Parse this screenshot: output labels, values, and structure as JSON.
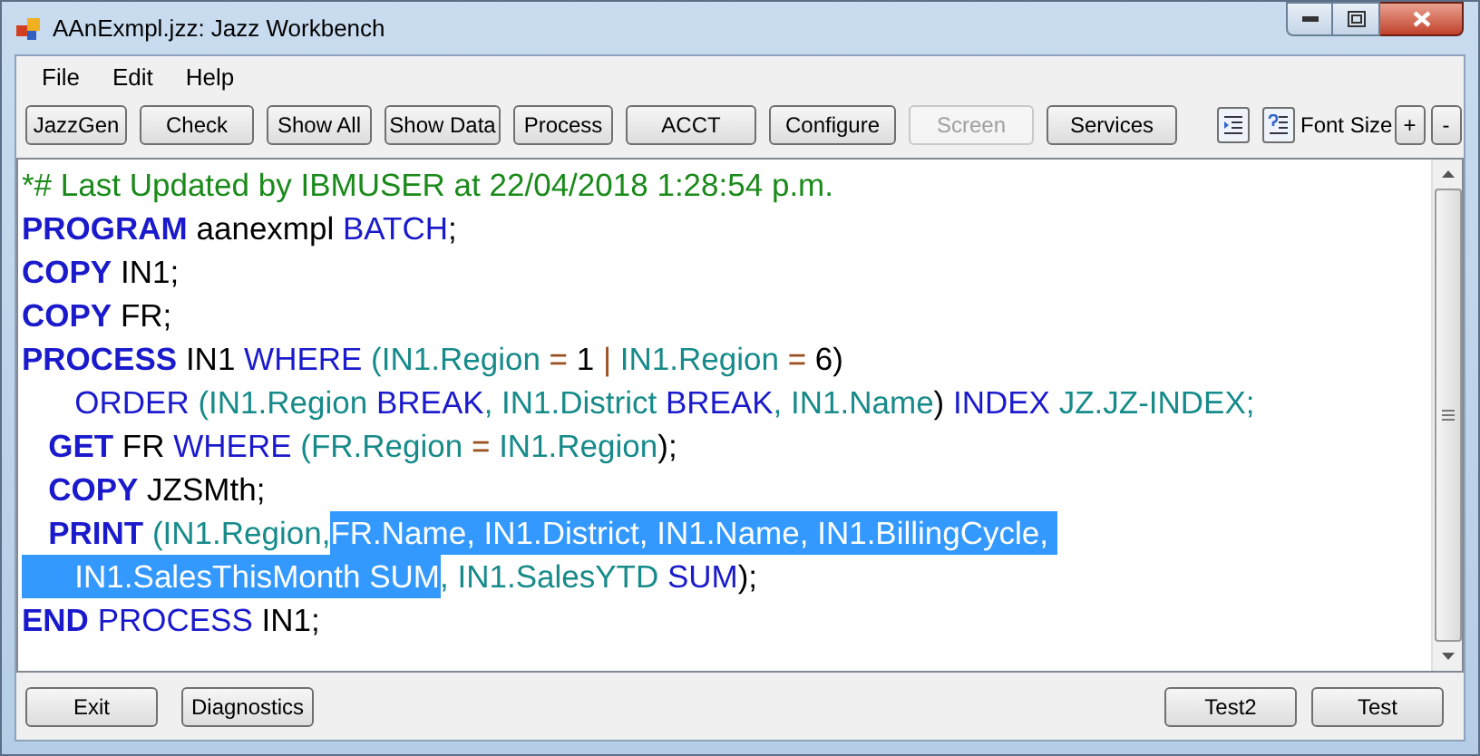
{
  "window": {
    "title": "AAnExmpl.jzz: Jazz Workbench"
  },
  "menu": [
    "File",
    "Edit",
    "Help"
  ],
  "toolbar": [
    {
      "label": "JazzGen",
      "disabled": false
    },
    {
      "label": "Check",
      "disabled": false
    },
    {
      "label": "Show All",
      "disabled": false
    },
    {
      "label": "Show Data",
      "disabled": false
    },
    {
      "label": "Process",
      "disabled": false
    },
    {
      "label": "ACCT",
      "disabled": false
    },
    {
      "label": "Configure",
      "disabled": false
    },
    {
      "label": "Screen",
      "disabled": true
    },
    {
      "label": "Services",
      "disabled": false
    }
  ],
  "font_size": {
    "label": "Font Size",
    "buttons": [
      "+",
      "-"
    ]
  },
  "editor": {
    "lines": [
      [
        {
          "text": "*# Last Updated by IBMUSER at 22/04/2018 1:28:54 p.m.",
          "kind": "comment",
          "selected": false
        }
      ],
      [
        {
          "text": "PROGRAM",
          "kind": "keyword",
          "selected": false
        },
        {
          "text": " aanexmpl ",
          "kind": "plain",
          "selected": false
        },
        {
          "text": "BATCH",
          "kind": "word",
          "selected": false
        },
        {
          "text": ";",
          "kind": "plain",
          "selected": false
        }
      ],
      [
        {
          "text": "COPY",
          "kind": "keyword",
          "selected": false
        },
        {
          "text": " IN1;",
          "kind": "plain",
          "selected": false
        }
      ],
      [
        {
          "text": "COPY",
          "kind": "keyword",
          "selected": false
        },
        {
          "text": " FR;",
          "kind": "plain",
          "selected": false
        }
      ],
      [
        {
          "text": "PROCESS",
          "kind": "keyword",
          "selected": false
        },
        {
          "text": " IN1 ",
          "kind": "plain",
          "selected": false
        },
        {
          "text": "WHERE",
          "kind": "word",
          "selected": false
        },
        {
          "text": " (IN1.Region ",
          "kind": "field",
          "selected": false
        },
        {
          "text": "=",
          "kind": "operator",
          "selected": false
        },
        {
          "text": " 1 ",
          "kind": "plain",
          "selected": false
        },
        {
          "text": "|",
          "kind": "operator",
          "selected": false
        },
        {
          "text": " IN1.Region ",
          "kind": "field",
          "selected": false
        },
        {
          "text": "=",
          "kind": "operator",
          "selected": false
        },
        {
          "text": " 6)",
          "kind": "plain",
          "selected": false
        }
      ],
      [
        {
          "text": "      ORDER ",
          "kind": "word",
          "selected": false
        },
        {
          "text": "(IN1.Region ",
          "kind": "field",
          "selected": false
        },
        {
          "text": "BREAK",
          "kind": "word",
          "selected": false
        },
        {
          "text": ", IN1.District ",
          "kind": "field",
          "selected": false
        },
        {
          "text": "BREAK",
          "kind": "word",
          "selected": false
        },
        {
          "text": ", IN1.Name",
          "kind": "field",
          "selected": false
        },
        {
          "text": ") ",
          "kind": "plain",
          "selected": false
        },
        {
          "text": "INDEX",
          "kind": "word",
          "selected": false
        },
        {
          "text": " JZ.JZ-INDEX;",
          "kind": "field",
          "selected": false
        }
      ],
      [
        {
          "text": "   GET",
          "kind": "keyword",
          "selected": false
        },
        {
          "text": " FR ",
          "kind": "plain",
          "selected": false
        },
        {
          "text": "WHERE",
          "kind": "word",
          "selected": false
        },
        {
          "text": " (FR.Region ",
          "kind": "field",
          "selected": false
        },
        {
          "text": "=",
          "kind": "operator",
          "selected": false
        },
        {
          "text": " IN1.Region",
          "kind": "field",
          "selected": false
        },
        {
          "text": ");",
          "kind": "plain",
          "selected": false
        }
      ],
      [
        {
          "text": "   COPY",
          "kind": "keyword",
          "selected": false
        },
        {
          "text": " JZSMth;",
          "kind": "plain",
          "selected": false
        }
      ],
      [
        {
          "text": "   PRINT",
          "kind": "keyword",
          "selected": false
        },
        {
          "text": " (IN1.Region,",
          "kind": "field",
          "selected": false
        },
        {
          "text": "FR.Name, IN1.District, IN1.Name, IN1.BillingCycle, ",
          "kind": "field",
          "selected": true
        }
      ],
      [
        {
          "text": "      IN1.SalesThisMonth SUM",
          "kind": "field",
          "selected": true
        },
        {
          "text": ", IN1.SalesYTD ",
          "kind": "field",
          "selected": false
        },
        {
          "text": "SUM",
          "kind": "word",
          "selected": false
        },
        {
          "text": ");",
          "kind": "plain",
          "selected": false
        }
      ],
      [
        {
          "text": "END",
          "kind": "keyword",
          "selected": false
        },
        {
          "text": " PROCESS",
          "kind": "word",
          "selected": false
        },
        {
          "text": " IN1;",
          "kind": "plain",
          "selected": false
        }
      ]
    ]
  },
  "bottom_left": [
    "Exit",
    "Diagnostics"
  ],
  "bottom_right": [
    "Test2",
    "Test"
  ]
}
